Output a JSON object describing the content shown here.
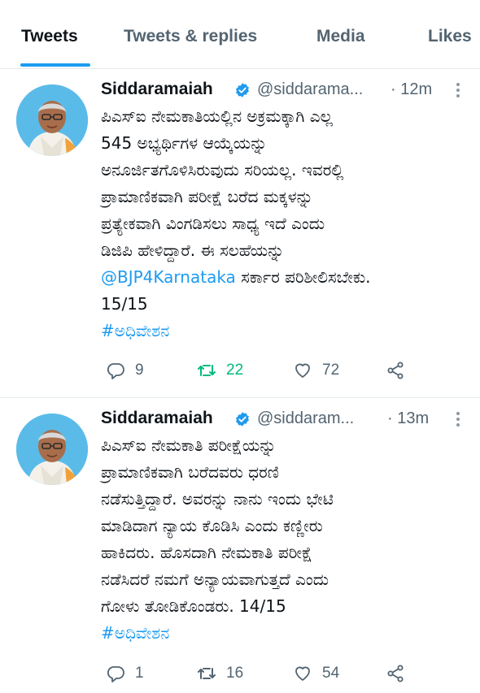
{
  "tabs": {
    "tweets": "Tweets",
    "tweets_replies": "Tweets & replies",
    "media": "Media",
    "likes": "Likes"
  },
  "colors": {
    "accent": "#1d9bf0",
    "retweeted": "#00ba7c",
    "muted": "#536471"
  },
  "tweets": [
    {
      "name": "Siddaramaiah",
      "handle": "@siddarama...",
      "time": "· 12m",
      "lines": [
        "ಪಿಎಸ್ಐ ನೇಮಕಾತಿಯಲ್ಲಿನ ಅಕ್ರಮಕ್ಕಾಗಿ  ಎಲ್ಲ",
        "545 ಅಭ್ಯರ್ಥಿಗಳ ಆಯ್ಕೆಯನ್ನು",
        "ಅನೂರ್ಜಿತಗೊಳಿಸಿರುವುದು ಸರಿಯಲ್ಲ. ಇವರಲ್ಲಿ",
        "ಪ್ರಾಮಾಣಿಕವಾಗಿ ಪರೀಕ್ಷೆ ಬರೆದ ಮಕ್ಕಳನ್ನು",
        "ಪ್ರತ್ಯೇಕವಾಗಿ ವಿಂಗಡಿಸಲು ಸಾಧ್ಯ ಇದೆ ಎಂದು",
        "ಡಿಜಿಪಿ ಹೇಳಿದ್ದಾರೆ. ಈ ಸಲಹೆಯನ್ನು"
      ],
      "mention": "@BJP4Karnataka",
      "mention_rest": " ಸರ್ಕಾರ ಪರಿಶೀಲಿಸಬೇಕು.",
      "counter": "15/15",
      "hashtag": "#ಅಧಿವೇಶನ",
      "replies": "9",
      "retweets": "22",
      "likes": "72",
      "retweeted": true
    },
    {
      "name": "Siddaramaiah",
      "handle": "@siddaram...",
      "time": "· 13m",
      "lines": [
        "ಪಿಎಸ್ಐ ನೇಮಕಾತಿ ಪರೀಕ್ಷೆಯನ್ನು",
        "ಪ್ರಾಮಾಣಿಕವಾಗಿ ಬರೆದವರು ಧರಣಿ",
        "ನಡೆಸುತ್ತಿದ್ದಾರೆ. ಅವರನ್ನು ನಾನು ಇಂದು ಭೇಟಿ",
        "ಮಾಡಿದಾಗ ನ್ಯಾಯ ಕೊಡಿಸಿ ಎಂದು ಕಣ್ಣೀರು",
        "ಹಾಕಿದರು. ಹೊಸದಾಗಿ ನೇಮಕಾತಿ ಪರೀಕ್ಷೆ",
        "ನಡೆಸಿದರೆ ನಮಗೆ ಅನ್ಯಾಯವಾಗುತ್ತದೆ ಎಂದು",
        "ಗೋಳು ತೋಡಿಕೊಂಡರು. 14/15"
      ],
      "hashtag": "#ಅಧಿವೇಶನ",
      "replies": "1",
      "retweets": "16",
      "likes": "54",
      "retweeted": false
    }
  ]
}
